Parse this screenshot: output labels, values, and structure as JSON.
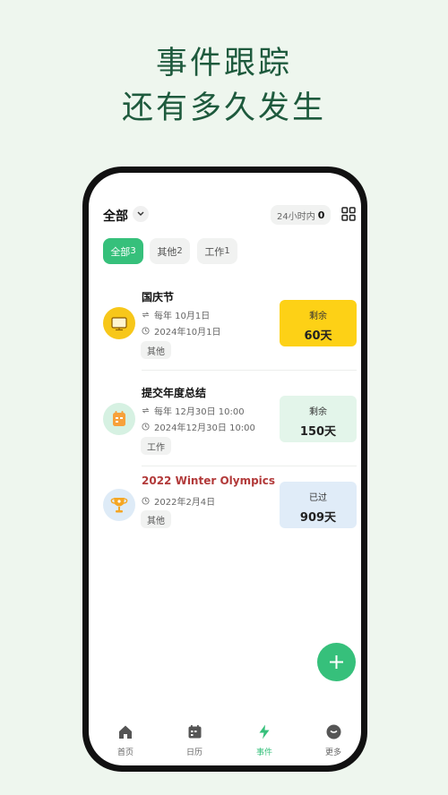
{
  "promo": {
    "line1": "事件跟踪",
    "line2": "还有多久发生"
  },
  "header": {
    "title": "全部",
    "pill_text": "24小时内",
    "pill_count": "0"
  },
  "chips": [
    {
      "label": "全部",
      "count": "3",
      "active": true
    },
    {
      "label": "其他",
      "count": "2",
      "active": false
    },
    {
      "label": "工作",
      "count": "1",
      "active": false
    }
  ],
  "events": [
    {
      "title": "国庆节",
      "repeat": "每年 10月1日",
      "date": "2024年10月1日",
      "tag": "其他",
      "status": "剩余",
      "days": "60天",
      "box_color": "#fdd116",
      "icon": "tv-icon"
    },
    {
      "title": "提交年度总结",
      "repeat": "每年 12月30日 10:00",
      "date": "2024年12月30日 10:00",
      "tag": "工作",
      "status": "剩余",
      "days": "150天",
      "box_color": "#e3f5ea",
      "icon": "calendar-icon"
    },
    {
      "title": "2022 Winter Olympics",
      "date": "2022年2月4日",
      "tag": "其他",
      "status": "已过",
      "days": "909天",
      "box_color": "#e0ecf8",
      "icon": "trophy-icon"
    }
  ],
  "nav": [
    {
      "label": "首页",
      "icon": "home-icon"
    },
    {
      "label": "日历",
      "icon": "calendar-icon"
    },
    {
      "label": "事件",
      "icon": "lightning-icon",
      "active": true
    },
    {
      "label": "更多",
      "icon": "more-icon"
    }
  ],
  "colors": {
    "accent": "#36c07b",
    "headline": "#1e5a3d",
    "past_title": "#b23a3a"
  }
}
